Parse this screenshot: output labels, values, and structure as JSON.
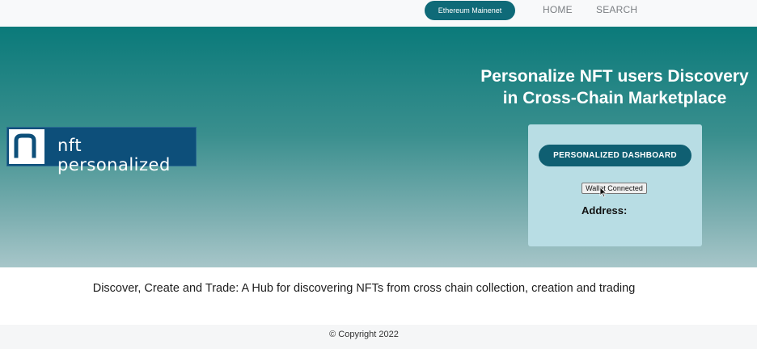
{
  "nav": {
    "network_label": "Ethereum Mainenet",
    "links": [
      "HOME",
      "SEARCH"
    ]
  },
  "hero": {
    "logo_text": "nft personalized",
    "logo_letter": "n",
    "title": "Personalize NFT users Discovery in Cross-Chain Marketplace",
    "dashboard_button": "PERSONALIZED DASHBOARD",
    "wallet_button": "Wallet Connected",
    "address_label": "Address:"
  },
  "tagline": "Discover, Create and Trade: A Hub for discovering NFTs from cross chain collection, creation and trading",
  "footer": {
    "copyright": "© Copyright 2022"
  },
  "colors": {
    "accent": "#0f6a78",
    "logo_bg": "#0d4f7a",
    "card_bg": "#b8dde4"
  }
}
